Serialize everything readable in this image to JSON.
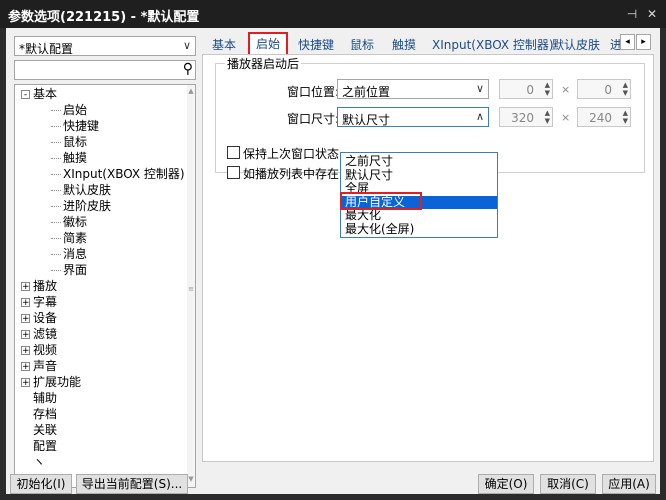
{
  "window": {
    "title": "参数选项(221215) - *默认配置",
    "pin_icon": "pin-icon",
    "close_icon": "close-icon"
  },
  "profile_combo": {
    "value": "*默认配置"
  },
  "tree": {
    "items": [
      {
        "label": "基本",
        "expander": "-"
      },
      {
        "label": "启始"
      },
      {
        "label": "快捷键"
      },
      {
        "label": "鼠标"
      },
      {
        "label": "触摸"
      },
      {
        "label": "XInput(XBOX 控制器)"
      },
      {
        "label": "默认皮肤"
      },
      {
        "label": "进阶皮肤"
      },
      {
        "label": "徽标"
      },
      {
        "label": "简素"
      },
      {
        "label": "消息"
      },
      {
        "label": "界面"
      },
      {
        "label": "播放",
        "expander": "+"
      },
      {
        "label": "字幕",
        "expander": "+"
      },
      {
        "label": "设备",
        "expander": "+"
      },
      {
        "label": "滤镜",
        "expander": "+"
      },
      {
        "label": "视频",
        "expander": "+"
      },
      {
        "label": "声音",
        "expander": "+"
      },
      {
        "label": "扩展功能",
        "expander": "+"
      },
      {
        "label": "辅助"
      },
      {
        "label": "存档"
      },
      {
        "label": "关联"
      },
      {
        "label": "配置"
      },
      {
        "label": "ヽ"
      }
    ]
  },
  "tabs": [
    {
      "label": "基本"
    },
    {
      "label": "启始",
      "active": true
    },
    {
      "label": "快捷键"
    },
    {
      "label": "鼠标"
    },
    {
      "label": "触摸"
    },
    {
      "label": "XInput(XBOX 控制器)"
    },
    {
      "label": "默认皮肤"
    },
    {
      "label": "进"
    }
  ],
  "startup": {
    "group_title": "播放器启动后",
    "position_label": "窗口位置:",
    "position_value": "之前位置",
    "position_x": "0",
    "position_y": "0",
    "size_label": "窗口尺寸:",
    "size_value": "默认尺寸",
    "size_w": "320",
    "size_h": "240",
    "times": "×",
    "check1": "保持上次窗口状态",
    "check2": "如播放列表中存在"
  },
  "size_dropdown": {
    "options": [
      {
        "label": "之前尺寸"
      },
      {
        "label": "默认尺寸"
      },
      {
        "label": "全屏"
      },
      {
        "label": "用户自定义",
        "selected": true
      },
      {
        "label": "最大化"
      },
      {
        "label": "最大化(全屏)"
      }
    ]
  },
  "footer": {
    "init": "初始化(I)",
    "export": "导出当前配置(S)...",
    "ok": "确定(O)",
    "cancel": "取消(C)",
    "apply": "应用(A)"
  },
  "colors": {
    "accent": "#0a64d8",
    "highlight_box": "#e02020"
  }
}
